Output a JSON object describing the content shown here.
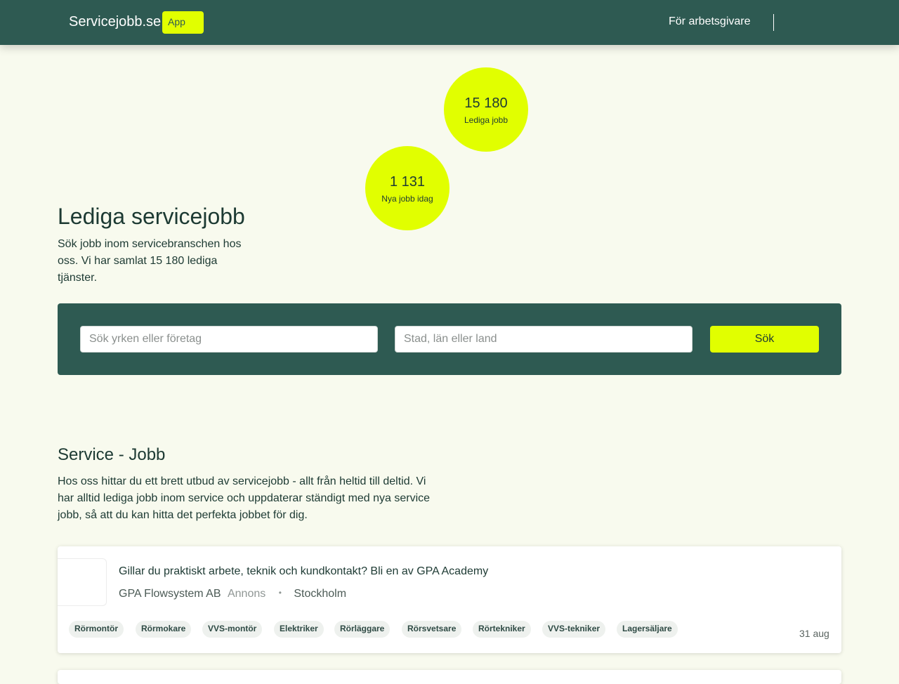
{
  "header": {
    "brand": "Servicejobb.se",
    "app_badge": "App",
    "employers_link": "För arbetsgivare"
  },
  "stats": [
    {
      "value": "15 180",
      "label": "Lediga jobb"
    },
    {
      "value": "1 131",
      "label": "Nya jobb idag"
    }
  ],
  "hero": {
    "title": "Lediga servicejobb",
    "subtitle": "Sök jobb inom servicebranschen hos oss. Vi har samlat 15 180 lediga tjänster."
  },
  "search": {
    "query_placeholder": "Sök yrken eller företag",
    "location_placeholder": "Stad, län eller land",
    "button_label": "Sök"
  },
  "section": {
    "title": "Service - Jobb",
    "text": "Hos oss hittar du ett brett utbud av servicejobb - allt från heltid till deltid. Vi har alltid lediga jobb inom service och uppdaterar ständigt med nya service jobb, så att du kan hitta det perfekta jobbet för dig."
  },
  "jobs": [
    {
      "title": "Gillar du praktiskt arbete, teknik och kundkontakt? Bli en av GPA Academy",
      "company": "GPA Flowsystem AB",
      "ad_label": "Annons",
      "separator": "•",
      "city": "Stockholm",
      "tags": [
        "Rörmontör",
        "Rörmokare",
        "VVS-montör",
        "Elektriker",
        "Rörläggare",
        "Rörsvetsare",
        "Rörtekniker",
        "VVS-tekniker",
        "Lagersäljare"
      ],
      "date": "31 aug"
    }
  ],
  "colors": {
    "header_bg": "#2e5a52",
    "accent": "#e1ff00",
    "page_bg": "#f8faee"
  }
}
